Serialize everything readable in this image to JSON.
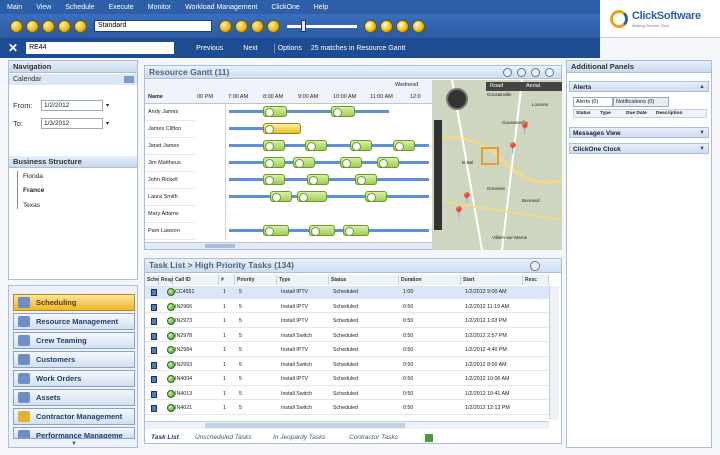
{
  "menu": [
    "Main",
    "View",
    "Schedule",
    "Execute",
    "Monitor",
    "Workload Management",
    "ClickOne",
    "Help"
  ],
  "toolbar": {
    "view_value": "Standard"
  },
  "logo": {
    "name": "ClickSoftware",
    "tagline": "Making Service Click"
  },
  "search": {
    "value": "RE44",
    "previous": "Previous",
    "next": "Next",
    "options": "Options",
    "count": "25 matches in Resource Gantt"
  },
  "navigation": {
    "title": "Navigation",
    "calendar": "Calendar",
    "from_label": "From:",
    "from_value": "1/2/2012",
    "to_label": "To:",
    "to_value": "1/3/2012",
    "bs_title": "Business Structure",
    "tree": [
      "Florida",
      "France",
      "Texas"
    ]
  },
  "bottom_nav": [
    "Scheduling",
    "Resource Management",
    "Crew Teaming",
    "Customers",
    "Work Orders",
    "Assets",
    "Contractor Management",
    "Performance Manageme"
  ],
  "gantt": {
    "title": "Resource Gantt (11)",
    "day": "Wednesd",
    "col_name": "Name",
    "times": [
      "00 PM",
      "7:00 AM",
      "8:00 AM",
      "9:00 AM",
      "10:00 AM",
      "11:00 AM",
      "12:0"
    ],
    "resources": [
      "Andy James",
      "James Clifton",
      "Janet James",
      "Jim Mattheus",
      "John Rickell",
      "Laura Smith",
      "Mary Adams",
      "Pam Lawson"
    ]
  },
  "map": {
    "road": "Road",
    "aerial": "Aerial",
    "places": [
      "Gousainville",
      "Louvres",
      "Goussanville",
      "le Bel",
      "Gonesse",
      "Bonneuil",
      "Villiers-sur-Marne"
    ]
  },
  "tasklist": {
    "title": "Task List > High Priority Tasks (134)",
    "columns": [
      "Sche",
      "Resp",
      "Call ID",
      "#",
      "Priority",
      "Type",
      "Status",
      "Duration",
      "Start",
      "Resc"
    ],
    "rows": [
      [
        "CC4551",
        "1",
        "5",
        "Install IPTV",
        "Scheduled",
        "1:00",
        "1/2/2012 9:00 AM"
      ],
      [
        "IN2966",
        "1",
        "5",
        "Install IPTV",
        "Scheduled",
        "0:50",
        "1/2/2012 11:19 AM"
      ],
      [
        "IN2973",
        "1",
        "5",
        "Install IPTV",
        "Scheduled",
        "0:50",
        "1/2/2012 1:03 PM"
      ],
      [
        "IN2978",
        "1",
        "5",
        "Install Switch",
        "Scheduled",
        "0:50",
        "1/2/2012 2:57 PM"
      ],
      [
        "IN2984",
        "1",
        "5",
        "Install IPTV",
        "Scheduled",
        "0:50",
        "1/2/2012 4:40 PM"
      ],
      [
        "IN2993",
        "1",
        "5",
        "Install Switch",
        "Scheduled",
        "0:50",
        "1/2/2012 8:00 AM"
      ],
      [
        "IN4004",
        "1",
        "5",
        "Install IPTV",
        "Scheduled",
        "0:50",
        "1/2/2012 10:06 AM"
      ],
      [
        "IN4013",
        "1",
        "5",
        "Install Switch",
        "Scheduled",
        "0:50",
        "1/2/2012 10:41 AM"
      ],
      [
        "IN4021",
        "1",
        "5",
        "Install Switch",
        "Scheduled",
        "0:50",
        "1/2/2012 12:13 PM"
      ]
    ],
    "tabs": [
      "Task List",
      "Unscheduled Tasks",
      "In Jeopardy Tasks",
      "Contractor Tasks"
    ]
  },
  "right": {
    "title": "Additional Panels",
    "alerts": "Alerts",
    "tab_alerts": "Alerts (0)",
    "tab_notifications": "Notifications (0)",
    "cols": [
      "Status",
      "Type",
      "Due Date",
      "Description"
    ],
    "messages": "Messages View",
    "clickone": "ClickOne Clock"
  }
}
